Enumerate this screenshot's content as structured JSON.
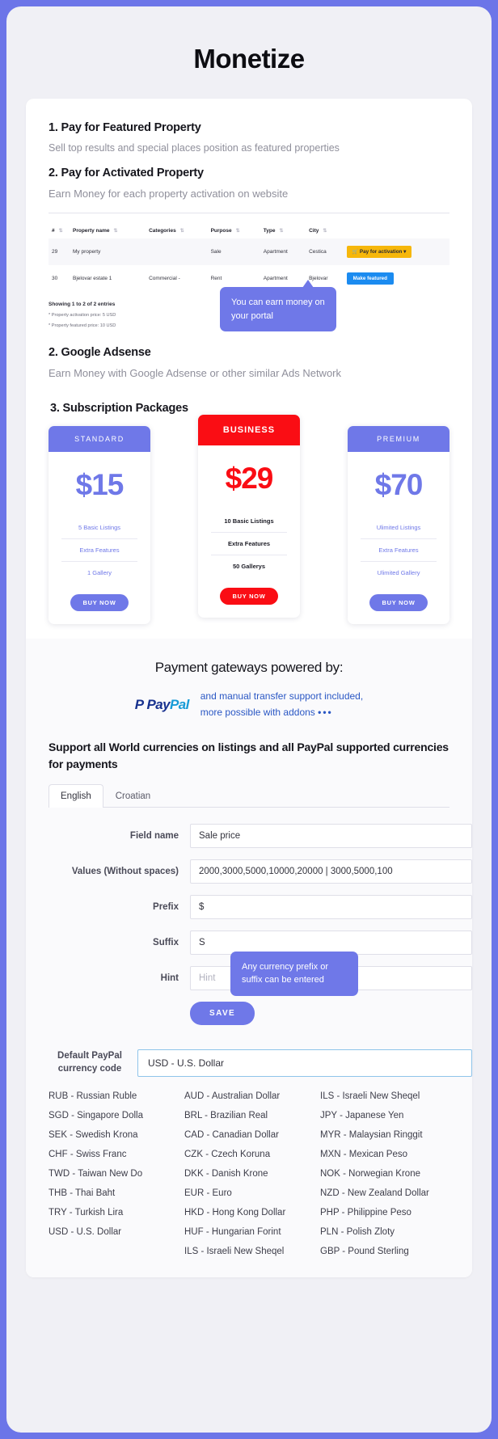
{
  "page": {
    "title": "Monetize"
  },
  "sections": {
    "featured": {
      "heading": "1. Pay for Featured Property",
      "subtext": "Sell top results and special places position as featured properties"
    },
    "activated": {
      "heading": "2. Pay for Activated Property",
      "subtext": "Earn Money for each property activation on website"
    },
    "adsense": {
      "heading": "2. Google Adsense",
      "subtext": "Earn Money with Google Adsense or other similar Ads Network"
    },
    "packages": {
      "heading": "3. Subscription Packages"
    }
  },
  "table": {
    "columns": [
      "#",
      "Property name",
      "Categories",
      "Purpose",
      "Type",
      "City",
      ""
    ],
    "sort_icon": "⇅",
    "rows": [
      {
        "num": "29",
        "name": "My property",
        "categories": "",
        "purpose": "Sale",
        "type": "Apartment",
        "city": "Cestica",
        "action": "Pay for activation",
        "action_icon": "cart-icon",
        "action_caret": "▾",
        "action_style": "activate"
      },
      {
        "num": "30",
        "name": "Bjelovar estate 1",
        "categories": "Commercial -",
        "purpose": "Rent",
        "type": "Apartment",
        "city": "Bjelovar",
        "action": "Make featured",
        "action_style": "featured"
      }
    ],
    "showing": "Showing 1 to 2 of 2 entries",
    "footnotes": [
      "* Property activation price: 5 USD",
      "* Property featured price: 10 USD"
    ],
    "tooltip": "You can earn money on your portal"
  },
  "plans": [
    {
      "name": "STANDARD",
      "price": "$15",
      "features": [
        "5 Basic Listings",
        "Extra Features",
        "1 Gallery"
      ],
      "button": "BUY NOW",
      "featured": false
    },
    {
      "name": "BUSINESS",
      "price": "$29",
      "features": [
        "10 Basic Listings",
        "Extra Features",
        "50 Gallerys"
      ],
      "button": "BUY NOW",
      "featured": true
    },
    {
      "name": "PREMIUM",
      "price": "$70",
      "features": [
        "Ulimited Listings",
        "Extra Features",
        "Ulimited Gallery"
      ],
      "button": "BUY NOW",
      "featured": false
    }
  ],
  "payment": {
    "title": "Payment gateways powered by:",
    "logo_part1": "Pay",
    "logo_part2": "Pal",
    "logo_mark": "P",
    "note_line1": "and manual transfer support included,",
    "note_line2": "more possible with addons",
    "note_dots": "•••",
    "support_heading": "Support all World currencies on listings and all PayPal supported currencies for payments"
  },
  "tabs": [
    {
      "label": "English",
      "active": true
    },
    {
      "label": "Croatian",
      "active": false
    }
  ],
  "form": {
    "fields": [
      {
        "label": "Field name",
        "value": "Sale price",
        "placeholder": "",
        "is_placeholder": false
      },
      {
        "label": "Values (Without spaces)",
        "value": "2000,3000,5000,10000,20000 | 3000,5000,100",
        "placeholder": "",
        "is_placeholder": false
      },
      {
        "label": "Prefix",
        "value": "$",
        "placeholder": "",
        "is_placeholder": false
      },
      {
        "label": "Suffix",
        "value": "S",
        "placeholder": "",
        "is_placeholder": false
      },
      {
        "label": "Hint",
        "value": "Hint",
        "placeholder": "Hint",
        "is_placeholder": true
      }
    ],
    "save_label": "SAVE",
    "tooltip": "Any currency prefix or suffix can be entered"
  },
  "currency": {
    "label_line1": "Default PayPal",
    "label_line2": "currency code",
    "selected": "USD - U.S. Dollar",
    "columns": [
      [
        "RUB - Russian Ruble",
        "SGD - Singapore Dolla",
        "SEK - Swedish Krona",
        "CHF - Swiss Franc",
        "TWD - Taiwan New Do",
        "THB - Thai Baht",
        "TRY - Turkish Lira",
        "USD - U.S. Dollar"
      ],
      [
        "AUD - Australian Dollar",
        "BRL - Brazilian Real",
        "CAD - Canadian Dollar",
        "CZK - Czech Koruna",
        "DKK - Danish Krone",
        "EUR - Euro",
        "HKD - Hong Kong Dollar",
        "HUF - Hungarian Forint",
        "ILS - Israeli New Sheqel"
      ],
      [
        "ILS - Israeli New Sheqel",
        "JPY - Japanese Yen",
        "MYR - Malaysian Ringgit",
        "MXN - Mexican Peso",
        "NOK - Norwegian Krone",
        "NZD - New Zealand Dollar",
        "PHP - Philippine Peso",
        "PLN - Polish Zloty",
        "GBP - Pound Sterling"
      ]
    ]
  },
  "colors": {
    "accent": "#6f78e8",
    "featured": "#fa0d14",
    "warning": "#f6b70b",
    "info": "#1b8bf0",
    "paypal_dark": "#18328f",
    "paypal_light": "#179bd7"
  }
}
